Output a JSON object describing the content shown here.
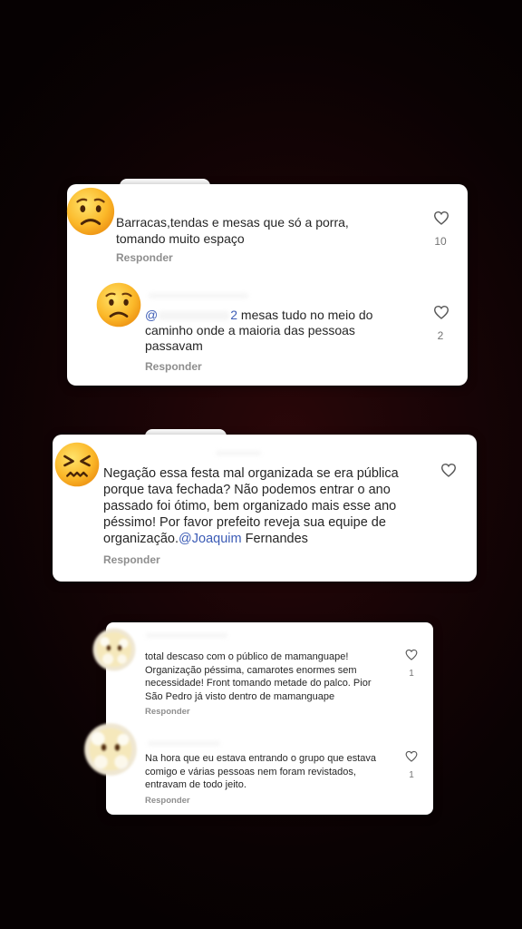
{
  "comments": [
    {
      "username": "",
      "text": "Barracas,tendas e mesas que só a porra, tomando muito espaço",
      "likes": "10",
      "reply_label": "Responder",
      "avatar": "worried-face-icon"
    },
    {
      "username": "",
      "mention": "@",
      "mention_suffix": "2",
      "text": " mesas tudo no meio do caminho onde a maioria das pessoas passavam",
      "likes": "2",
      "reply_label": "Responder",
      "avatar": "worried-face-icon"
    },
    {
      "username": "",
      "text": "Negação essa festa mal organizada se era pública porque tava fechada? Não podemos entrar o ano passado foi ótimo, bem organizado mais esse ano péssimo! Por favor prefeito reveja sua equipe de organização.",
      "mention": "@Joaquim",
      "mention_tail": " Fernandes",
      "reply_label": "Responder",
      "avatar": "confounded-face-icon"
    },
    {
      "text": "total descaso com o público de mamanguape! Organização péssima, camarotes enormes sem necessidade! Front tomando metade do palco. Pior São Pedro já visto dentro de mamanguape",
      "likes": "1",
      "reply_label": "Responder",
      "avatar": "blurred-avatar-icon"
    },
    {
      "username": "",
      "text": "Na hora que eu estava entrando o grupo que estava comigo e várias pessoas nem foram revistados, entravam de todo jeito.",
      "likes": "1",
      "reply_label": "Responder",
      "avatar": "blurred-avatar-icon"
    }
  ],
  "colors": {
    "accent_link": "#3b5bb5",
    "reply_gray": "#8e8e8e"
  }
}
